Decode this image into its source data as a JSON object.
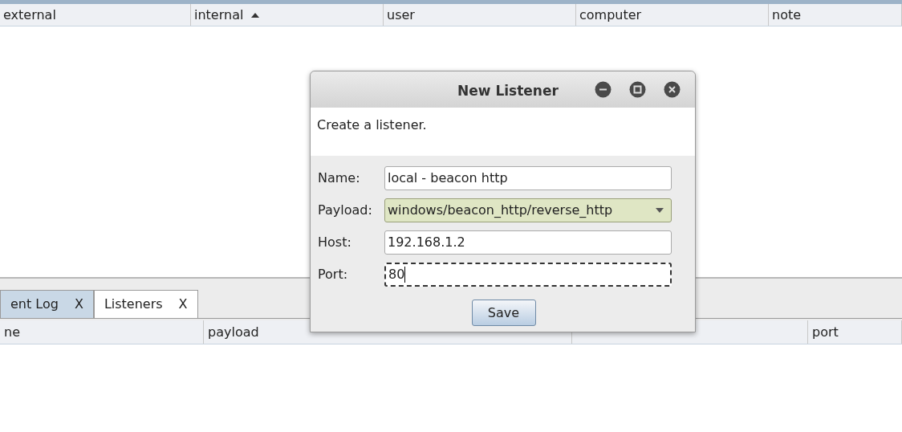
{
  "top_table": {
    "columns": [
      {
        "label": "external",
        "sorted": false
      },
      {
        "label": "internal",
        "sorted": true
      },
      {
        "label": "user",
        "sorted": false
      },
      {
        "label": "computer",
        "sorted": false
      },
      {
        "label": "note",
        "sorted": false
      }
    ]
  },
  "tabs": [
    {
      "label": "ent Log",
      "close": "X",
      "selected": false
    },
    {
      "label": "Listeners",
      "close": "X",
      "selected": true
    }
  ],
  "bottom_table": {
    "columns": [
      "ne",
      "payload",
      "port"
    ]
  },
  "dialog": {
    "title": "New Listener",
    "description": "Create a listener.",
    "fields": [
      {
        "label": "Name:",
        "kind": "text",
        "value": "local - beacon http",
        "focused": false
      },
      {
        "label": "Payload:",
        "kind": "select",
        "value": "windows/beacon_http/reverse_http",
        "focused": false
      },
      {
        "label": "Host:",
        "kind": "text",
        "value": "192.168.1.2",
        "focused": false
      },
      {
        "label": "Port:",
        "kind": "text",
        "value": "80",
        "focused": true
      }
    ],
    "button": "Save"
  }
}
